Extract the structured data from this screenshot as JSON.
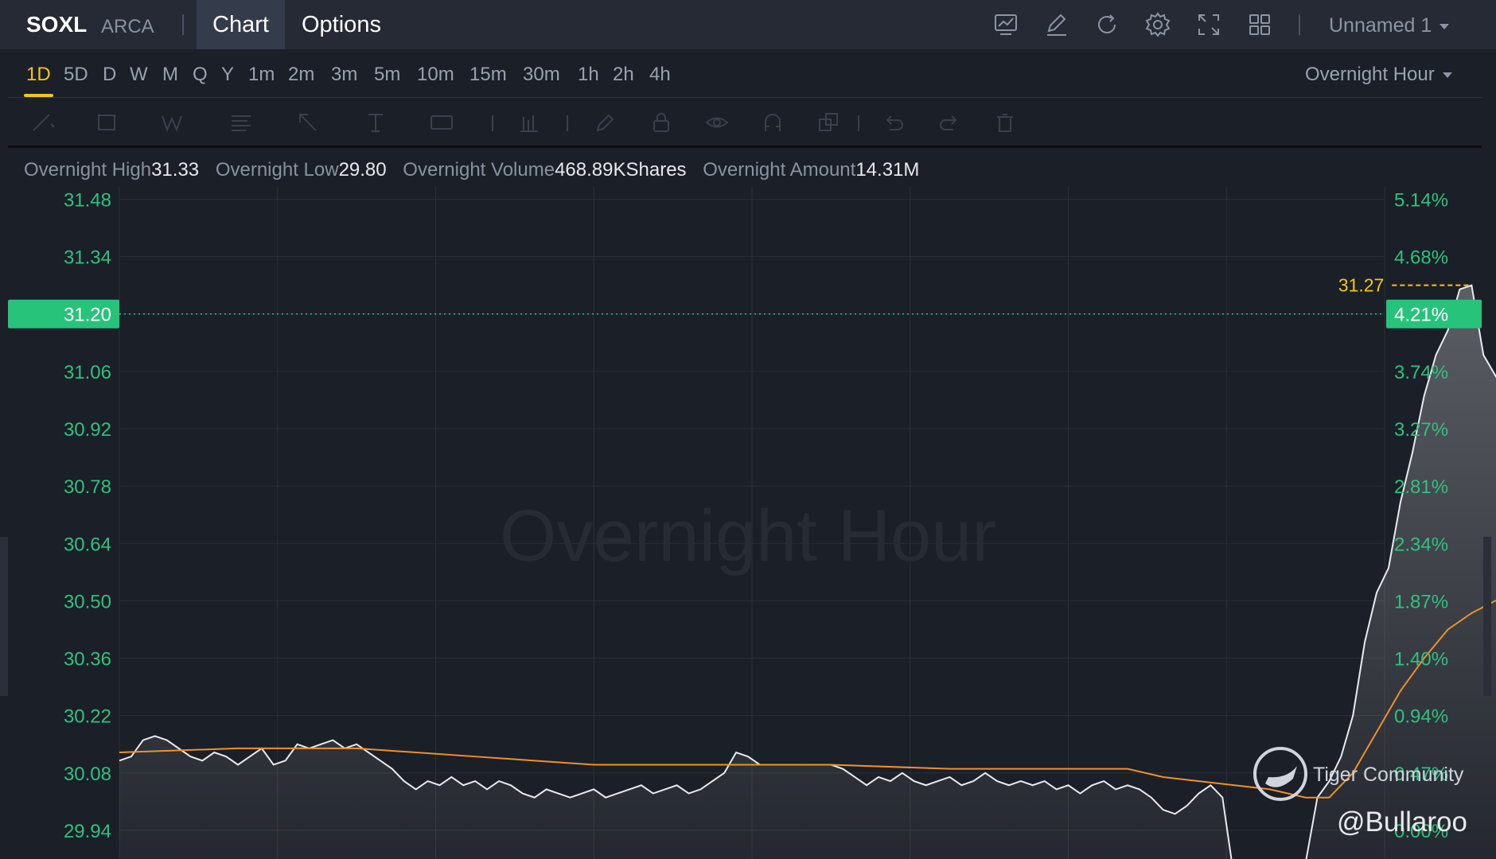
{
  "header": {
    "symbol": "SOXL",
    "exchange": "ARCA",
    "tabs": [
      "Chart",
      "Options"
    ],
    "layout_name": "Unnamed 1",
    "icons": [
      "indicators-icon",
      "draw-icon",
      "refresh-icon",
      "settings-icon",
      "fullscreen-icon",
      "layout-grid-icon"
    ]
  },
  "intervals": {
    "items": [
      "1D",
      "5D",
      "D",
      "W",
      "M",
      "Q",
      "Y",
      "1m",
      "2m",
      "3m",
      "5m",
      "10m",
      "15m",
      "30m",
      "1h",
      "2h",
      "4h"
    ],
    "active": "1D",
    "session": "Overnight Hour"
  },
  "stats": {
    "high_label": "Overnight High",
    "high_value": "31.33",
    "low_label": "Overnight Low",
    "low_value": "29.80",
    "volume_label": "Overnight Volume",
    "volume_value": "468.89KShares",
    "amount_label": "Overnight Amount",
    "amount_value": "14.31M"
  },
  "chart_data": {
    "type": "line",
    "watermark": "Overnight Hour",
    "ylim": [
      29.87,
      31.51
    ],
    "y_ticks": [
      "31.48",
      "31.34",
      "31.20",
      "31.06",
      "30.92",
      "30.78",
      "30.64",
      "30.50",
      "30.36",
      "30.22",
      "30.08",
      "29.94"
    ],
    "y_ticks_pct": [
      "5.14%",
      "4.68%",
      "4.21%",
      "3.74%",
      "3.27%",
      "2.81%",
      "2.34%",
      "1.87%",
      "1.40%",
      "0.94%",
      "0.47%",
      "0.00%"
    ],
    "current_price": "31.20",
    "current_pct": "4.21%",
    "peak_label": "31.27",
    "x_count": 320,
    "series": [
      {
        "color": "#e8ebf0",
        "points": [
          [
            0,
            30.11
          ],
          [
            3,
            30.12
          ],
          [
            6,
            30.16
          ],
          [
            9,
            30.17
          ],
          [
            12,
            30.16
          ],
          [
            15,
            30.14
          ],
          [
            18,
            30.12
          ],
          [
            21,
            30.11
          ],
          [
            24,
            30.13
          ],
          [
            27,
            30.12
          ],
          [
            30,
            30.1
          ],
          [
            33,
            30.12
          ],
          [
            36,
            30.14
          ],
          [
            39,
            30.1
          ],
          [
            42,
            30.11
          ],
          [
            45,
            30.15
          ],
          [
            48,
            30.14
          ],
          [
            51,
            30.15
          ],
          [
            54,
            30.16
          ],
          [
            57,
            30.14
          ],
          [
            60,
            30.15
          ],
          [
            63,
            30.13
          ],
          [
            66,
            30.11
          ],
          [
            69,
            30.09
          ],
          [
            72,
            30.06
          ],
          [
            75,
            30.04
          ],
          [
            78,
            30.06
          ],
          [
            81,
            30.05
          ],
          [
            84,
            30.07
          ],
          [
            87,
            30.05
          ],
          [
            90,
            30.06
          ],
          [
            93,
            30.04
          ],
          [
            96,
            30.06
          ],
          [
            99,
            30.05
          ],
          [
            102,
            30.03
          ],
          [
            105,
            30.02
          ],
          [
            108,
            30.04
          ],
          [
            111,
            30.03
          ],
          [
            114,
            30.02
          ],
          [
            117,
            30.03
          ],
          [
            120,
            30.04
          ],
          [
            123,
            30.02
          ],
          [
            126,
            30.03
          ],
          [
            129,
            30.04
          ],
          [
            132,
            30.05
          ],
          [
            135,
            30.03
          ],
          [
            138,
            30.04
          ],
          [
            141,
            30.05
          ],
          [
            144,
            30.03
          ],
          [
            147,
            30.04
          ],
          [
            150,
            30.06
          ],
          [
            153,
            30.08
          ],
          [
            156,
            30.13
          ],
          [
            159,
            30.12
          ],
          [
            162,
            30.1
          ],
          [
            165,
            30.1
          ],
          [
            168,
            30.1
          ],
          [
            171,
            30.1
          ],
          [
            174,
            30.1
          ],
          [
            177,
            30.1
          ],
          [
            180,
            30.1
          ],
          [
            183,
            30.09
          ],
          [
            186,
            30.07
          ],
          [
            189,
            30.05
          ],
          [
            192,
            30.07
          ],
          [
            195,
            30.06
          ],
          [
            198,
            30.08
          ],
          [
            201,
            30.06
          ],
          [
            204,
            30.05
          ],
          [
            207,
            30.06
          ],
          [
            210,
            30.07
          ],
          [
            213,
            30.05
          ],
          [
            216,
            30.06
          ],
          [
            219,
            30.08
          ],
          [
            222,
            30.06
          ],
          [
            225,
            30.05
          ],
          [
            228,
            30.06
          ],
          [
            231,
            30.05
          ],
          [
            234,
            30.06
          ],
          [
            237,
            30.04
          ],
          [
            240,
            30.05
          ],
          [
            243,
            30.03
          ],
          [
            246,
            30.05
          ],
          [
            249,
            30.06
          ],
          [
            252,
            30.04
          ],
          [
            255,
            30.05
          ],
          [
            258,
            30.04
          ],
          [
            261,
            30.02
          ],
          [
            264,
            29.99
          ],
          [
            267,
            29.98
          ],
          [
            270,
            30.0
          ],
          [
            273,
            30.03
          ],
          [
            276,
            30.05
          ],
          [
            279,
            30.02
          ],
          [
            282,
            29.82
          ],
          [
            285,
            29.85
          ],
          [
            288,
            29.86
          ],
          [
            291,
            29.84
          ],
          [
            294,
            29.86
          ],
          [
            297,
            29.85
          ],
          [
            300,
            29.86
          ],
          [
            303,
            30.02
          ],
          [
            306,
            30.06
          ],
          [
            309,
            30.12
          ],
          [
            312,
            30.22
          ],
          [
            315,
            30.4
          ],
          [
            318,
            30.52
          ],
          [
            321,
            30.58
          ],
          [
            324,
            30.74
          ],
          [
            327,
            30.86
          ],
          [
            330,
            31.0
          ],
          [
            333,
            31.1
          ],
          [
            336,
            31.16
          ],
          [
            339,
            31.26
          ],
          [
            342,
            31.27
          ],
          [
            345,
            31.1
          ],
          [
            348,
            31.05
          ],
          [
            351,
            31.0
          ],
          [
            354,
            31.08
          ],
          [
            357,
            31.2
          ]
        ]
      },
      {
        "color": "#f0902a",
        "points": [
          [
            0,
            30.13
          ],
          [
            30,
            30.14
          ],
          [
            60,
            30.14
          ],
          [
            75,
            30.13
          ],
          [
            90,
            30.12
          ],
          [
            105,
            30.11
          ],
          [
            120,
            30.1
          ],
          [
            150,
            30.1
          ],
          [
            180,
            30.1
          ],
          [
            210,
            30.09
          ],
          [
            240,
            30.09
          ],
          [
            255,
            30.09
          ],
          [
            264,
            30.07
          ],
          [
            273,
            30.06
          ],
          [
            282,
            30.05
          ],
          [
            291,
            30.04
          ],
          [
            300,
            30.02
          ],
          [
            306,
            30.02
          ],
          [
            312,
            30.08
          ],
          [
            318,
            30.18
          ],
          [
            324,
            30.28
          ],
          [
            330,
            30.36
          ],
          [
            336,
            30.43
          ],
          [
            342,
            30.47
          ],
          [
            348,
            30.5
          ],
          [
            357,
            30.51
          ]
        ]
      }
    ],
    "community_label": "Tiger Community",
    "handle": "@Bullaroo"
  }
}
